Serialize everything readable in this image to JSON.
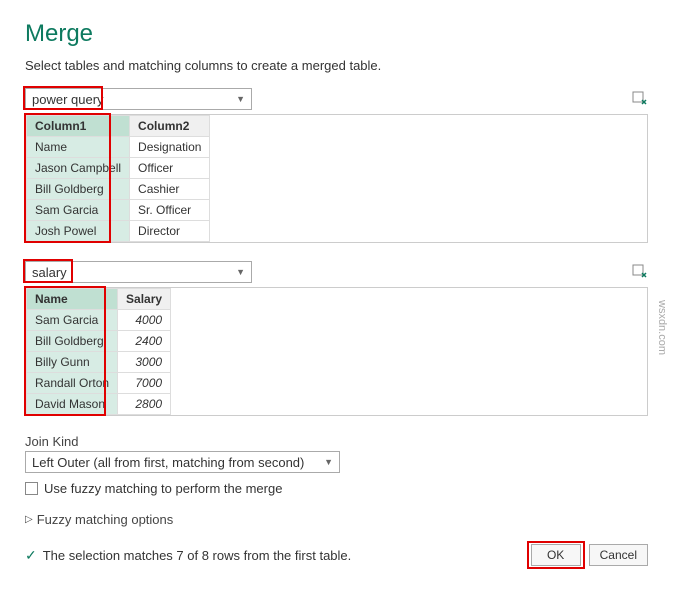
{
  "title": "Merge",
  "subtitle": "Select tables and matching columns to create a merged table.",
  "table1": {
    "name": "power query",
    "columns": [
      "Column1",
      "Column2"
    ],
    "rows": [
      [
        "Name",
        "Designation"
      ],
      [
        "Jason Campbell",
        "Officer"
      ],
      [
        "Bill Goldberg",
        "Cashier"
      ],
      [
        "Sam Garcia",
        "Sr. Officer"
      ],
      [
        "Josh Powel",
        "Director"
      ]
    ]
  },
  "table2": {
    "name": "salary",
    "columns": [
      "Name",
      "Salary"
    ],
    "rows": [
      [
        "Sam Garcia",
        "4000"
      ],
      [
        "Bill Goldberg",
        "2400"
      ],
      [
        "Billy Gunn",
        "3000"
      ],
      [
        "Randall Orton",
        "7000"
      ],
      [
        "David Mason",
        "2800"
      ]
    ]
  },
  "join": {
    "label": "Join Kind",
    "selected": "Left Outer (all from first, matching from second)"
  },
  "fuzzy_checkbox": "Use fuzzy matching to perform the merge",
  "fuzzy_expander": "Fuzzy matching options",
  "status": "The selection matches 7 of 8 rows from the first table.",
  "buttons": {
    "ok": "OK",
    "cancel": "Cancel"
  },
  "watermark": "wsxdn.com"
}
